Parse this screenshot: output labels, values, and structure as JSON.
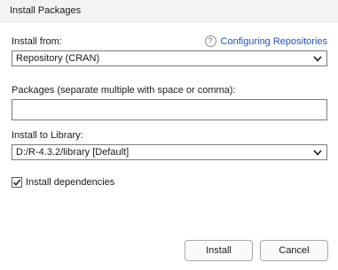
{
  "window": {
    "title": "Install Packages"
  },
  "install_from": {
    "label": "Install from:",
    "selected": "Repository (CRAN)",
    "help": {
      "icon": "question-circle-icon",
      "link_text": "Configuring Repositories"
    }
  },
  "packages": {
    "label": "Packages (separate multiple with space or comma):",
    "value": ""
  },
  "library": {
    "label": "Install to Library:",
    "selected": "D:/R-4.3.2/library [Default]"
  },
  "dependencies": {
    "label": "Install dependencies",
    "checked": true
  },
  "buttons": {
    "install": "Install",
    "cancel": "Cancel"
  },
  "colors": {
    "link": "#1f4fbf",
    "titlebar": "#f3f3f3"
  }
}
